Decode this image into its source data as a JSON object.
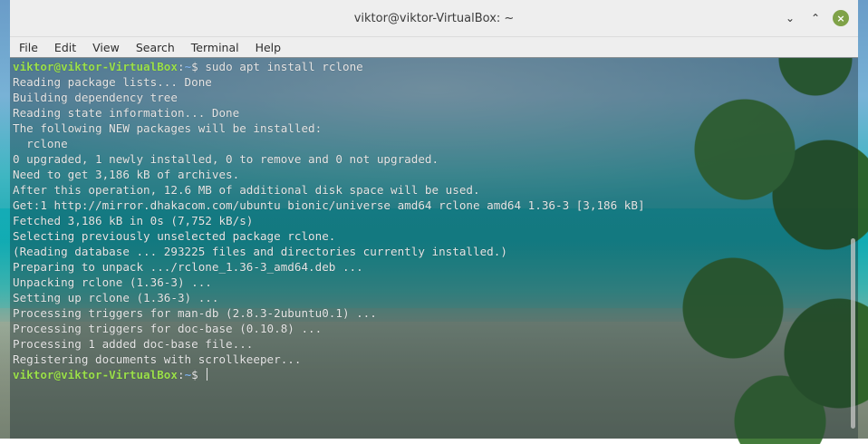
{
  "window": {
    "title": "viktor@viktor-VirtualBox: ~",
    "controls": {
      "minimize": "⌄",
      "restore": "⌃",
      "close": "×"
    }
  },
  "menu": {
    "items": [
      "File",
      "Edit",
      "View",
      "Search",
      "Terminal",
      "Help"
    ]
  },
  "prompt": {
    "user": "viktor@viktor-VirtualBox",
    "sep": ":",
    "path": "~",
    "symbol": "$"
  },
  "commands": {
    "first": " sudo apt install rclone"
  },
  "output": [
    "Reading package lists... Done",
    "Building dependency tree",
    "Reading state information... Done",
    "The following NEW packages will be installed:",
    "  rclone",
    "0 upgraded, 1 newly installed, 0 to remove and 0 not upgraded.",
    "Need to get 3,186 kB of archives.",
    "After this operation, 12.6 MB of additional disk space will be used.",
    "Get:1 http://mirror.dhakacom.com/ubuntu bionic/universe amd64 rclone amd64 1.36-3 [3,186 kB]",
    "Fetched 3,186 kB in 0s (7,752 kB/s)",
    "Selecting previously unselected package rclone.",
    "(Reading database ... 293225 files and directories currently installed.)",
    "Preparing to unpack .../rclone_1.36-3_amd64.deb ...",
    "Unpacking rclone (1.36-3) ...",
    "Setting up rclone (1.36-3) ...",
    "Processing triggers for man-db (2.8.3-2ubuntu0.1) ...",
    "Processing triggers for doc-base (0.10.8) ...",
    "Processing 1 added doc-base file...",
    "Registering documents with scrollkeeper..."
  ]
}
